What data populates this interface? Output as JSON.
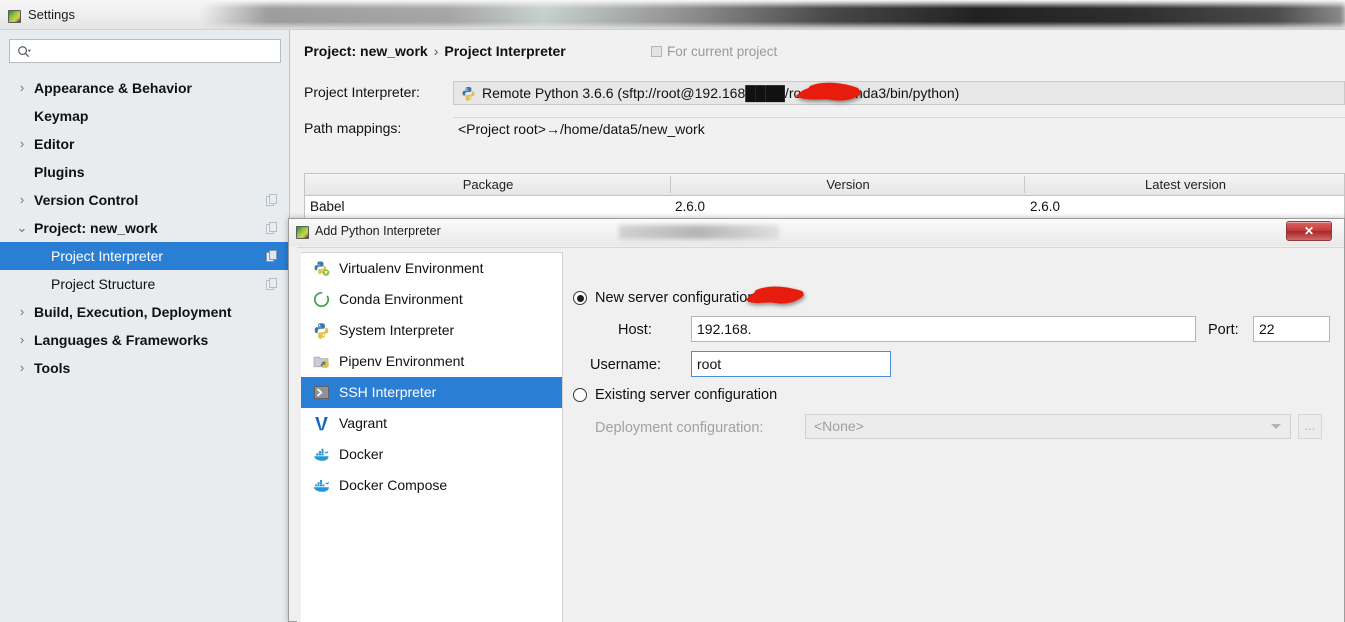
{
  "window": {
    "title": "Settings",
    "icon": "pycharm-icon"
  },
  "sidebar": {
    "search": {
      "placeholder": "",
      "value": "",
      "icon": "search-icon"
    },
    "items": [
      {
        "label": "Appearance & Behavior",
        "level": 0,
        "arrow": "›",
        "selected": false,
        "copy_icon": false
      },
      {
        "label": "Keymap",
        "level": 0,
        "arrow": "",
        "selected": false,
        "copy_icon": false
      },
      {
        "label": "Editor",
        "level": 0,
        "arrow": "›",
        "selected": false,
        "copy_icon": false
      },
      {
        "label": "Plugins",
        "level": 0,
        "arrow": "",
        "selected": false,
        "copy_icon": false
      },
      {
        "label": "Version Control",
        "level": 0,
        "arrow": "›",
        "selected": false,
        "copy_icon": true
      },
      {
        "label": "Project: new_work",
        "level": 0,
        "arrow": "⌄",
        "selected": false,
        "copy_icon": true
      },
      {
        "label": "Project Interpreter",
        "level": 1,
        "arrow": "",
        "selected": true,
        "copy_icon": true
      },
      {
        "label": "Project Structure",
        "level": 1,
        "arrow": "",
        "selected": false,
        "copy_icon": true
      },
      {
        "label": "Build, Execution, Deployment",
        "level": 0,
        "arrow": "›",
        "selected": false,
        "copy_icon": false
      },
      {
        "label": "Languages & Frameworks",
        "level": 0,
        "arrow": "›",
        "selected": false,
        "copy_icon": false
      },
      {
        "label": "Tools",
        "level": 0,
        "arrow": "›",
        "selected": false,
        "copy_icon": false
      }
    ]
  },
  "content": {
    "breadcrumb": {
      "parent": "Project: new_work",
      "separator": "›",
      "current": "Project Interpreter"
    },
    "for_current_project": "For current project",
    "interpreter_label": "Project Interpreter:",
    "interpreter_value": "Remote Python 3.6.6 (sftp://root@192.168████/root/anaconda3/bin/python)",
    "path_mappings_label": "Path mappings:",
    "path_mappings_value": "<Project root>→/home/data5/new_work",
    "table": {
      "headers": [
        "Package",
        "Version",
        "Latest version"
      ],
      "rows": [
        {
          "package": "Babel",
          "version": "2.6.0",
          "latest": "2.6.0"
        }
      ]
    }
  },
  "dialog": {
    "title": "Add Python Interpreter",
    "icon": "pycharm-icon",
    "close_label": "✕",
    "env_list": [
      {
        "label": "Virtualenv Environment",
        "icon": "virtualenv-icon",
        "selected": false
      },
      {
        "label": "Conda Environment",
        "icon": "conda-icon",
        "selected": false
      },
      {
        "label": "System Interpreter",
        "icon": "python-icon",
        "selected": false
      },
      {
        "label": "Pipenv Environment",
        "icon": "pipenv-icon",
        "selected": false
      },
      {
        "label": "SSH Interpreter",
        "icon": "ssh-terminal-icon",
        "selected": true
      },
      {
        "label": "Vagrant",
        "icon": "vagrant-icon",
        "selected": false
      },
      {
        "label": "Docker",
        "icon": "docker-icon",
        "selected": false
      },
      {
        "label": "Docker Compose",
        "icon": "docker-compose-icon",
        "selected": false
      }
    ],
    "new_server": {
      "radio_label": "New server configuration",
      "selected": true,
      "host_label": "Host:",
      "host_value": "192.168.",
      "port_label": "Port:",
      "port_value": "22",
      "username_label": "Username:",
      "username_value": "root"
    },
    "existing_server": {
      "radio_label": "Existing server configuration",
      "selected": false,
      "deployment_label": "Deployment configuration:",
      "deployment_value": "<None>",
      "browse_label": "..."
    }
  },
  "colors": {
    "selection_blue": "#2a7fd4",
    "dialog_bg": "#f0f0f0",
    "sidebar_bg": "#e9ecef",
    "redaction_red": "#e81b0f",
    "focus_border": "#4a90d9"
  }
}
